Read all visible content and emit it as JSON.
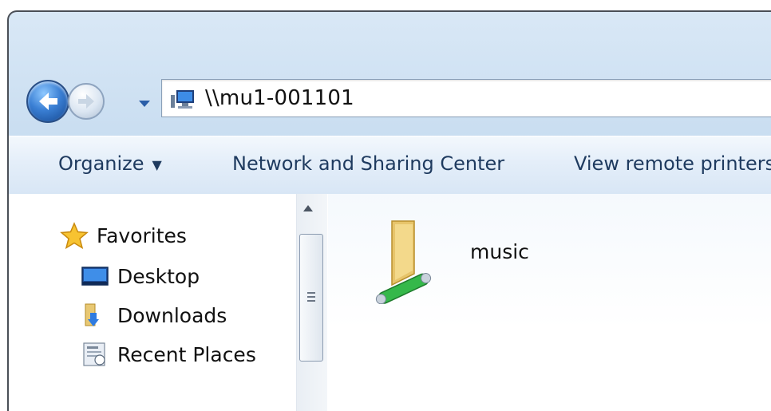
{
  "address": {
    "path": "\\\\mu1-001101",
    "location_icon": "network-computer-icon"
  },
  "navigation": {
    "back_icon": "back-arrow-icon",
    "forward_icon": "forward-arrow-icon",
    "history_icon": "chevron-down-icon"
  },
  "command_bar": {
    "organize_label": "Organize",
    "network_label": "Network and Sharing Center",
    "printers_label": "View remote printers"
  },
  "nav_pane": {
    "favorites_label": "Favorites",
    "items": [
      {
        "label": "Desktop",
        "icon": "desktop-icon"
      },
      {
        "label": "Downloads",
        "icon": "downloads-folder-icon"
      },
      {
        "label": "Recent Places",
        "icon": "recent-places-icon"
      }
    ]
  },
  "files": [
    {
      "name": "music",
      "icon": "shared-folder-icon"
    }
  ],
  "colors": {
    "accent": "#3a7fd4",
    "command_text": "#1e3a5f"
  }
}
